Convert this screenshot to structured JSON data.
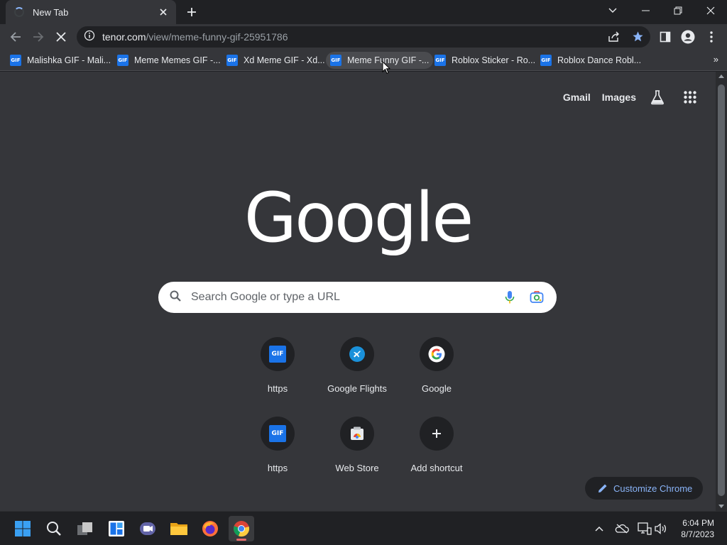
{
  "tab": {
    "title": "New Tab"
  },
  "omnibox": {
    "host": "tenor.com",
    "path": "/view/meme-funny-gif-25951786"
  },
  "bookmarks": [
    {
      "label": "Malishka GIF - Mali..."
    },
    {
      "label": "Meme Memes GIF -..."
    },
    {
      "label": "Xd Meme GIF - Xd..."
    },
    {
      "label": "Meme Funny GIF -..."
    },
    {
      "label": "Roblox Sticker - Ro..."
    },
    {
      "label": "Roblox Dance Robl..."
    }
  ],
  "bookmarks_more": "»",
  "gif_icon_text": "GIF",
  "toplinks": {
    "gmail": "Gmail",
    "images": "Images"
  },
  "logo": "Google",
  "search": {
    "placeholder": "Search Google or type a URL"
  },
  "shortcuts": [
    {
      "label": "https",
      "icon": "gif-icon"
    },
    {
      "label": "Google Flights",
      "icon": "flights-icon"
    },
    {
      "label": "Google",
      "icon": "google-g-icon"
    },
    {
      "label": "https",
      "icon": "gif-icon"
    },
    {
      "label": "Web Store",
      "icon": "web-store-icon"
    },
    {
      "label": "Add shortcut",
      "icon": "plus-icon"
    }
  ],
  "customize": {
    "label": "Customize Chrome"
  },
  "clock": {
    "time": "6:04 PM",
    "date": "8/7/2023"
  },
  "colors": {
    "accent": "#8ab4f8",
    "bookmark_star": "#8ab4f8",
    "gif_blue": "#1a73e8"
  }
}
